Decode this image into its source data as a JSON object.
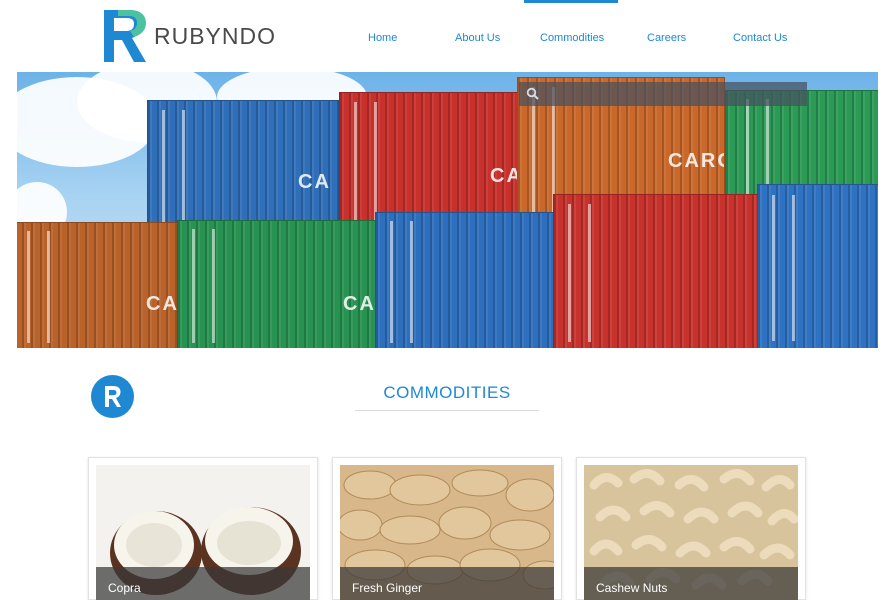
{
  "brand": {
    "name": "RUBYNDO",
    "color": "#1e88d2",
    "accent": "#4cc2a0"
  },
  "nav": {
    "items": [
      {
        "label": "Home"
      },
      {
        "label": "About Us"
      },
      {
        "label": "Commodities"
      },
      {
        "label": "Careers"
      },
      {
        "label": "Contact Us"
      }
    ],
    "active": "Commodities"
  },
  "search": {
    "placeholder": "",
    "icon": "search-icon"
  },
  "hero": {
    "image": "shipping-containers",
    "container_text": [
      "CA",
      "CA",
      "CARG",
      "CA",
      "CA"
    ]
  },
  "section": {
    "title": "COMMODITIES",
    "icon": "rubyndo-logo-icon"
  },
  "cards": [
    {
      "label": "Copra"
    },
    {
      "label": "Fresh Ginger"
    },
    {
      "label": "Cashew Nuts"
    }
  ]
}
